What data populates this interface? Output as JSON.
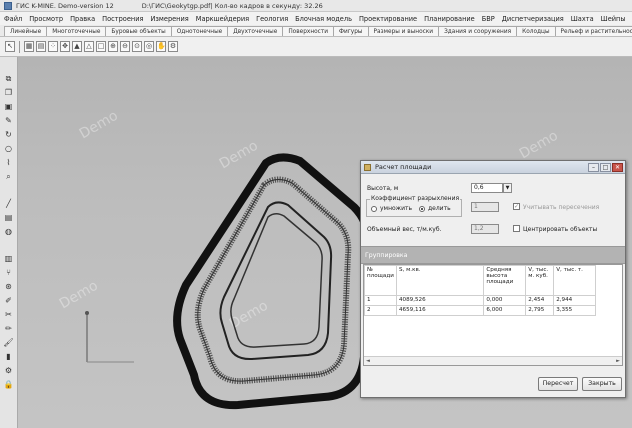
{
  "window": {
    "app_title": "ГИС K-MINE. Demo-version 12",
    "file_path": "D:\\ГИС\\Geokytgp.pdf| Кол-во кадров в секунду: 32.26"
  },
  "menu": [
    "Файл",
    "Просмотр",
    "Правка",
    "Построения",
    "Измерения",
    "Маркшейдерия",
    "Геология",
    "Блочная модель",
    "Проектирование",
    "Планирование",
    "БВР",
    "Диспетчеризация",
    "Шахта",
    "Шейпы",
    "Служебные"
  ],
  "tabs": [
    "Линейные",
    "Многоточечные",
    "Буровые объекты",
    "Однотонечные",
    "Двухточечные",
    "Поверхности",
    "Фигуры",
    "Размеры и выноски",
    "Здания и сооружения",
    "Колодцы",
    "Рельеф и растительность",
    "Объе"
  ],
  "toolbar_icons": [
    "cursor-icon",
    "grid-icon",
    "layers-icon",
    "points-icon",
    "move-icon",
    "triangle-icon",
    "triangle-outline-icon",
    "rectangle-icon",
    "zoom-in-icon",
    "zoom-out-icon",
    "zoom-window-icon",
    "zoom-fit-icon",
    "pan-icon",
    "settings-icon"
  ],
  "watermark": "Demo",
  "dialog": {
    "title": "Расчет площади",
    "height_label": "Высота, м",
    "height_value": "0,6",
    "coef_group_label": "Коэффициент разрыхления",
    "radio_multiply": "умножить",
    "radio_divide": "делить",
    "coef_value": "1",
    "weight_label": "Объемный вес, т/м.куб.",
    "weight_value": "1,2",
    "check_intersections": "Учитывать пересечения",
    "check_center": "Центрировать объекты",
    "section_label": "Группировка",
    "columns": [
      "№ площади",
      "S, м.кв.",
      "Средняя высота площади",
      "V, тыс. м. куб.",
      "V, тыс. т."
    ],
    "rows": [
      [
        "1",
        "4089,526",
        "0,000",
        "2,454",
        "2,944"
      ],
      [
        "2",
        "4659,116",
        "6,000",
        "2,795",
        "3,355"
      ]
    ],
    "recalc_button": "Пересчет",
    "close_button": "Закрыть"
  }
}
